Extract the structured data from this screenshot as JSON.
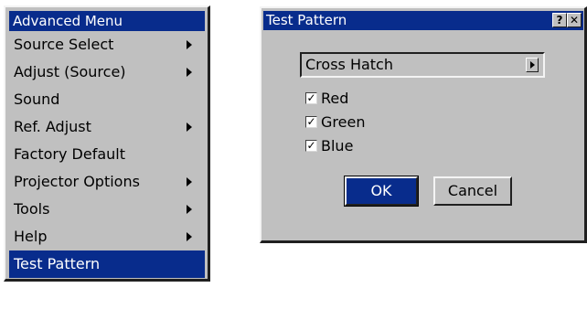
{
  "advanced_menu": {
    "title": "Advanced Menu",
    "items": [
      {
        "label": "Source Select",
        "submenu": true
      },
      {
        "label": "Adjust (Source)",
        "submenu": true
      },
      {
        "label": "Sound",
        "submenu": false
      },
      {
        "label": "Ref. Adjust",
        "submenu": true
      },
      {
        "label": "Factory Default",
        "submenu": false
      },
      {
        "label": "Projector Options",
        "submenu": true
      },
      {
        "label": "Tools",
        "submenu": true
      },
      {
        "label": "Help",
        "submenu": true
      },
      {
        "label": "Test Pattern",
        "submenu": false,
        "selected": true
      }
    ]
  },
  "test_pattern_dialog": {
    "title": "Test Pattern",
    "help_glyph": "?",
    "close_glyph": "✕",
    "pattern_select": {
      "value": "Cross Hatch"
    },
    "checkboxes": [
      {
        "label": "Red",
        "checked": true
      },
      {
        "label": "Green",
        "checked": true
      },
      {
        "label": "Blue",
        "checked": true
      }
    ],
    "check_glyph": "✓",
    "ok_label": "OK",
    "cancel_label": "Cancel"
  },
  "colors": {
    "face": "#c0c0c0",
    "highlight": "#082c8c",
    "highlight_text": "#ffffff"
  }
}
